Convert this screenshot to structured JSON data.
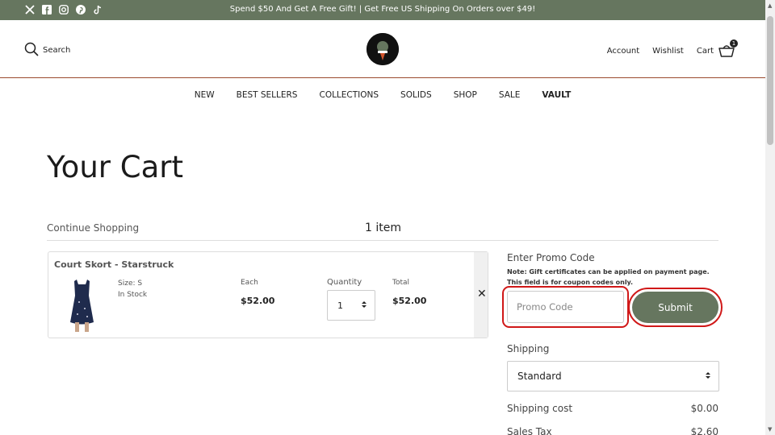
{
  "topbar": {
    "message": "Spend $50 And Get A Free Gift! | Get Free US Shipping On Orders over $49!",
    "social": [
      "x-icon",
      "facebook-icon",
      "instagram-icon",
      "pinterest-icon",
      "tiktok-icon"
    ]
  },
  "header": {
    "search_label": "Search",
    "account": "Account",
    "wishlist": "Wishlist",
    "cart": "Cart",
    "cart_count": "1"
  },
  "nav": [
    "NEW",
    "BEST SELLERS",
    "COLLECTIONS",
    "SOLIDS",
    "SHOP",
    "SALE",
    "VAULT"
  ],
  "page": {
    "title": "Your Cart",
    "continue_shopping": "Continue Shopping",
    "item_count": "1 item"
  },
  "cart_item": {
    "name": "Court Skort - Starstruck",
    "size": "Size: S",
    "stock": "In Stock",
    "each_label": "Each",
    "each_price": "$52.00",
    "quantity_label": "Quantity",
    "quantity": "1",
    "total_label": "Total",
    "total_price": "$52.00",
    "remove": "✕"
  },
  "promo": {
    "title": "Enter Promo Code",
    "note": "Note: Gift certificates can be applied on payment page. This field is for coupon codes only.",
    "placeholder": "Promo Code",
    "submit": "Submit"
  },
  "shipping": {
    "label": "Shipping",
    "selected": "Standard",
    "cost_label": "Shipping cost",
    "cost_value": "$0.00",
    "tax_label": "Sales Tax",
    "tax_value": "$2.60"
  },
  "colors": {
    "brand_green": "#66765f",
    "header_rule": "#9a4a2e",
    "highlight": "#d01818"
  }
}
